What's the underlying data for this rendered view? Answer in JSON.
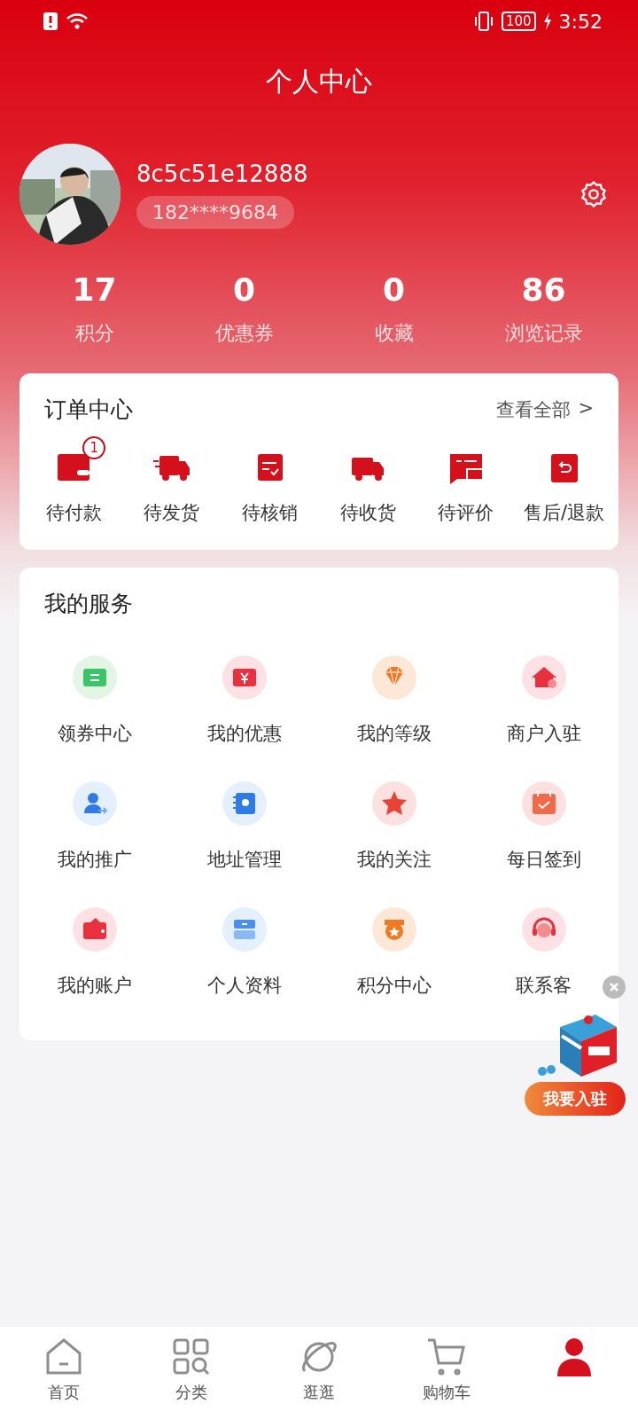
{
  "status_bar": {
    "time": "3:52",
    "battery": "100"
  },
  "header": {
    "title": "个人中心"
  },
  "profile": {
    "username": "8c5c51e12888",
    "phone": "182****9684"
  },
  "stats": [
    {
      "value": "17",
      "label": "积分"
    },
    {
      "value": "0",
      "label": "优惠券"
    },
    {
      "value": "0",
      "label": "收藏"
    },
    {
      "value": "86",
      "label": "浏览记录"
    }
  ],
  "orders": {
    "title": "订单中心",
    "view_all": "查看全部",
    "chevron": ">",
    "items": [
      {
        "label": "待付款",
        "badge": "1"
      },
      {
        "label": "待发货"
      },
      {
        "label": "待核销"
      },
      {
        "label": "待收货"
      },
      {
        "label": "待评价"
      },
      {
        "label": "售后/退款"
      }
    ]
  },
  "services": {
    "title": "我的服务",
    "items": [
      {
        "label": "领券中心"
      },
      {
        "label": "我的优惠"
      },
      {
        "label": "我的等级"
      },
      {
        "label": "商户入驻"
      },
      {
        "label": "我的推广"
      },
      {
        "label": "地址管理"
      },
      {
        "label": "我的关注"
      },
      {
        "label": "每日签到"
      },
      {
        "label": "我的账户"
      },
      {
        "label": "个人资料"
      },
      {
        "label": "积分中心"
      },
      {
        "label": "联系客"
      }
    ]
  },
  "floating_ad": {
    "button": "我要入驻"
  },
  "tab_bar": [
    {
      "label": "首页",
      "selected": false
    },
    {
      "label": "分类",
      "selected": false
    },
    {
      "label": "逛逛",
      "selected": false
    },
    {
      "label": "购物车",
      "selected": false
    },
    {
      "selected": true
    }
  ]
}
